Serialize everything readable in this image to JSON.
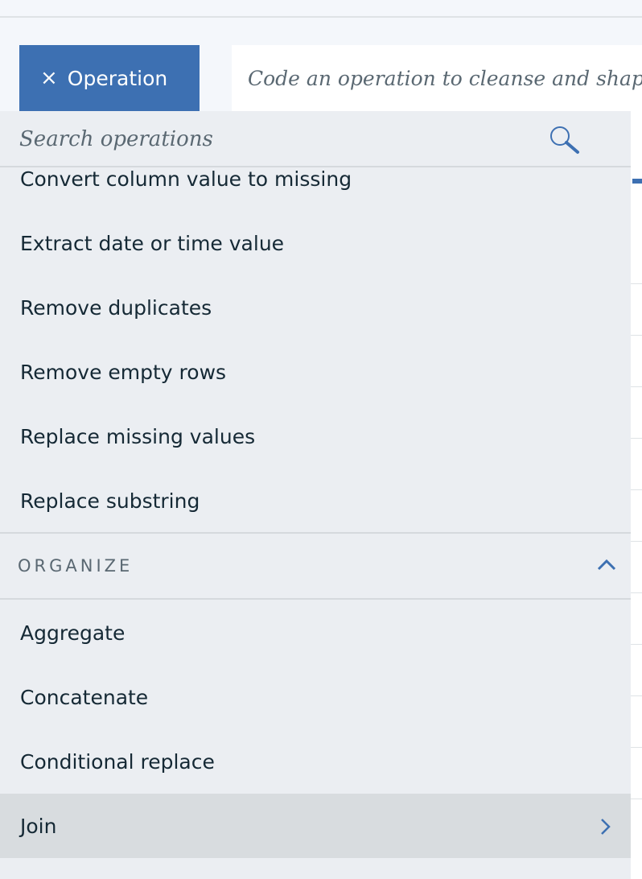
{
  "toolbar": {
    "operation_button_label": "Operation",
    "close_glyph": "×",
    "code_placeholder": "Code an operation to cleanse and shape you"
  },
  "search": {
    "placeholder": "Search operations",
    "icon": "search-icon"
  },
  "operations_above": [
    {
      "label": "Convert column value to missing"
    },
    {
      "label": "Extract date or time value"
    },
    {
      "label": "Remove duplicates"
    },
    {
      "label": "Remove empty rows"
    },
    {
      "label": "Replace missing values"
    },
    {
      "label": "Replace substring"
    }
  ],
  "organize_section": {
    "title": "ORGANIZE",
    "icon": "chevron-up-icon",
    "items": [
      {
        "label": "Aggregate"
      },
      {
        "label": "Concatenate"
      },
      {
        "label": "Conditional replace"
      },
      {
        "label": "Join",
        "selected": true,
        "icon": "chevron-right-icon"
      }
    ]
  },
  "colors": {
    "accent": "#3d70b2",
    "panel_bg": "#ebeef2",
    "selected_bg": "#d8dcdf",
    "text": "#152935",
    "muted_text": "#5a6872"
  }
}
